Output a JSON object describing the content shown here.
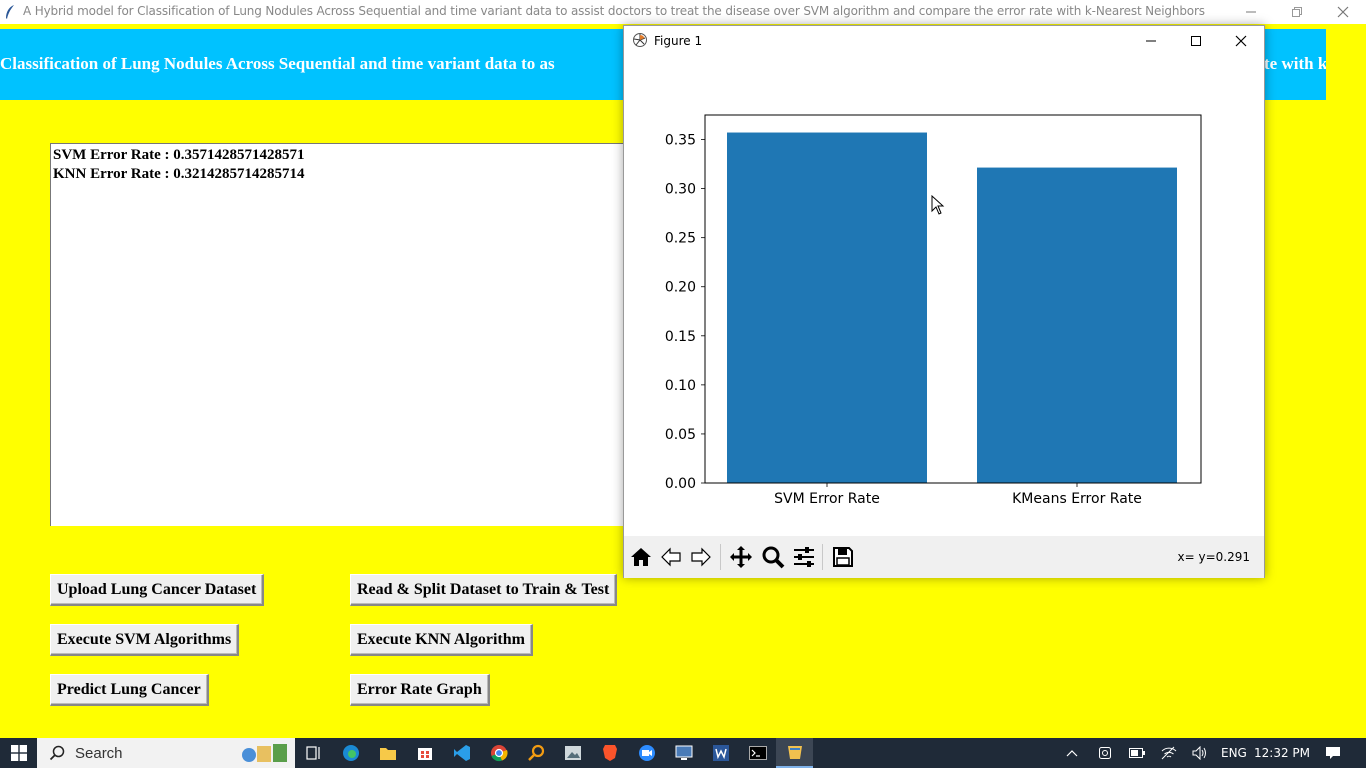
{
  "window": {
    "title": "A Hybrid model for Classification of Lung Nodules Across Sequential and time variant data  to assist doctors to treat the disease over SVM algorithm and compare the error rate with k-Nearest Neighbors"
  },
  "banner": {
    "visible_left": "Classification of Lung Nodules Across Sequential and time variant data  to as",
    "visible_right": "te with k"
  },
  "output": {
    "lines": [
      "SVM Error Rate : 0.3571428571428571",
      "KNN Error Rate : 0.3214285714285714"
    ]
  },
  "buttons": {
    "upload": "Upload Lung Cancer Dataset",
    "read_split": "Read & Split Dataset to Train & Test",
    "svm": "Execute SVM Algorithms",
    "knn": "Execute KNN Algorithm",
    "predict": "Predict Lung Cancer",
    "graph": "Error Rate Graph"
  },
  "figure": {
    "title": "Figure 1",
    "coord_readout": "x= y=0.291",
    "toolbar": [
      "home-icon",
      "back-icon",
      "forward-icon",
      "pan-icon",
      "zoom-icon",
      "configure-subplots-icon",
      "save-icon"
    ]
  },
  "chart_data": {
    "type": "bar",
    "categories": [
      "SVM Error Rate",
      "KMeans Error Rate"
    ],
    "values": [
      0.3571428571428571,
      0.3214285714285714
    ],
    "title": "",
    "xlabel": "",
    "ylabel": "",
    "ylim": [
      0,
      0.375
    ],
    "yticks": [
      "0.00",
      "0.05",
      "0.10",
      "0.15",
      "0.20",
      "0.25",
      "0.30",
      "0.35"
    ],
    "bar_color": "#1f77b4",
    "grid": false
  },
  "taskbar": {
    "search_placeholder": "Search",
    "language": "ENG",
    "time": "12:32 PM"
  },
  "colors": {
    "background": "#ffff00",
    "banner": "#00c2ff",
    "taskbar": "#1f2a38"
  }
}
